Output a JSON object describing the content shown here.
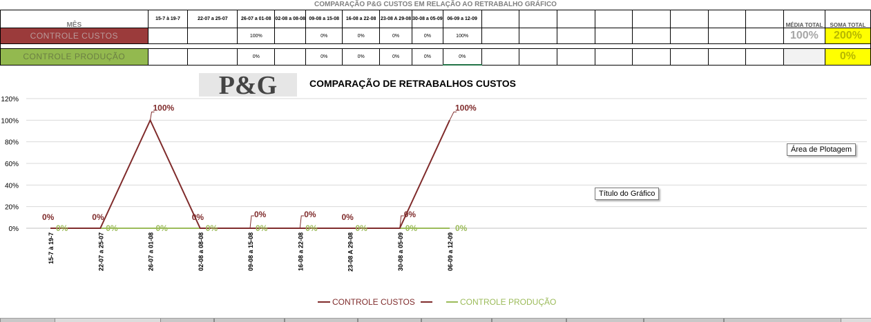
{
  "sheet": {
    "title": "COMPARAÇÃO P&G  CUSTOS EM RELAÇÃO AO RETRABALHO GRÁFICO",
    "mes_label": "MÊS",
    "media_total_label": "MÉDIA TOTAL",
    "soma_total_label": "SOMA TOTAL",
    "week_headers": [
      "15-7 à 19-7",
      "22-07 a 25-07",
      "26-07 a 01-08",
      "02-08 a 08-08",
      "09-08 a 15-08",
      "16-08 a 22-08",
      "23-08 A 29-08",
      "30-08 a 05-09",
      "06-09 a 12-09"
    ],
    "rows": [
      {
        "label": "CONTROLE CUSTOS",
        "values": [
          "",
          "",
          "100%",
          "",
          "0%",
          "0%",
          "0%",
          "0%",
          "100%"
        ],
        "media": "100%",
        "soma": "200%"
      },
      {
        "label": "CONTROLE PRODUÇÃO",
        "values": [
          "",
          "",
          "0%",
          "",
          "0%",
          "0%",
          "0%",
          "0%",
          "0%"
        ],
        "media": "",
        "soma": "0%"
      }
    ]
  },
  "logo_text": "P&G",
  "tooltips": {
    "plot_area": "Área de Plotagem",
    "chart_title": "Título do Gráfico"
  },
  "chart_data": {
    "type": "line",
    "title": "COMPARAÇÃO DE RETRABALHOS  CUSTOS",
    "categories": [
      "15-7 à 19-7",
      "22-07 a 25-07",
      "26-07 a 01-08",
      "02-08 a 08-08",
      "09-08 a 15-08",
      "16-08 a 22-08",
      "23-08 A 29-08",
      "30-08 a 05-09",
      "06-09 a 12-09"
    ],
    "ylim": [
      0,
      120
    ],
    "yticks": [
      "0%",
      "20%",
      "40%",
      "60%",
      "80%",
      "100%",
      "120%"
    ],
    "grid": true,
    "legend": "bottom",
    "series": [
      {
        "name": "CONTROLE CUSTOS",
        "color": "#7f2b2b",
        "values": [
          0,
          0,
          100,
          0,
          0,
          0,
          0,
          0,
          100
        ],
        "labels": [
          "0%",
          "0%",
          "100%",
          "0%",
          "0%",
          "0%",
          "0%",
          "0%",
          "100%"
        ]
      },
      {
        "name": "CONTROLE PRODUÇÃO",
        "color": "#9bbb59",
        "values": [
          0,
          0,
          0,
          0,
          0,
          0,
          0,
          0,
          0
        ],
        "labels": [
          "0%",
          "0%",
          "0%",
          "0%",
          "0%",
          "0%",
          "0%",
          "0%",
          "0%"
        ]
      }
    ]
  }
}
